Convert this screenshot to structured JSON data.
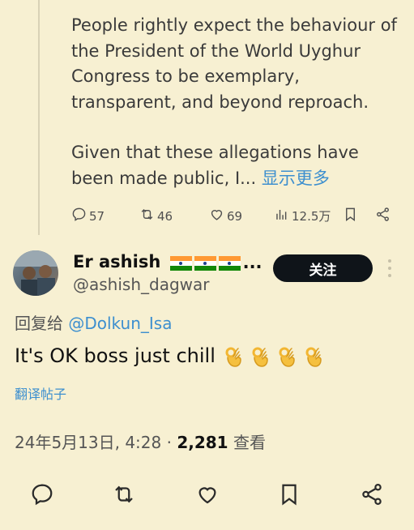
{
  "quoted_tweet": {
    "paragraph1": "People rightly expect the behaviour of the President of the World Uyghur Congress to be exemplary, transparent, and beyond reproach.",
    "paragraph2": "Given that these allegations have been made public, I...",
    "show_more": "显示更多",
    "metrics": {
      "replies": "57",
      "retweets": "46",
      "likes": "69",
      "views": "12.5万"
    }
  },
  "author": {
    "name": "Er ashish",
    "name_suffix": "...",
    "handle": "@ashish_dagwar",
    "follow_label": "关注"
  },
  "reply": {
    "prefix": "回复给",
    "mention": "@Dolkun_Isa"
  },
  "tweet": {
    "text": "It's OK boss just chill",
    "emoji_count": 4
  },
  "translate_label": "翻译帖子",
  "meta": {
    "date": "24年5月13日, 4:28 · ",
    "views_count": "2,281",
    "views_label": " 查看"
  },
  "colors": {
    "background": "#f7f0d2",
    "link": "#3d8fcf",
    "button": "#0f1419"
  },
  "icons": [
    "reply-icon",
    "retweet-icon",
    "like-icon",
    "views-icon",
    "bookmark-icon",
    "share-icon",
    "more-icon"
  ]
}
